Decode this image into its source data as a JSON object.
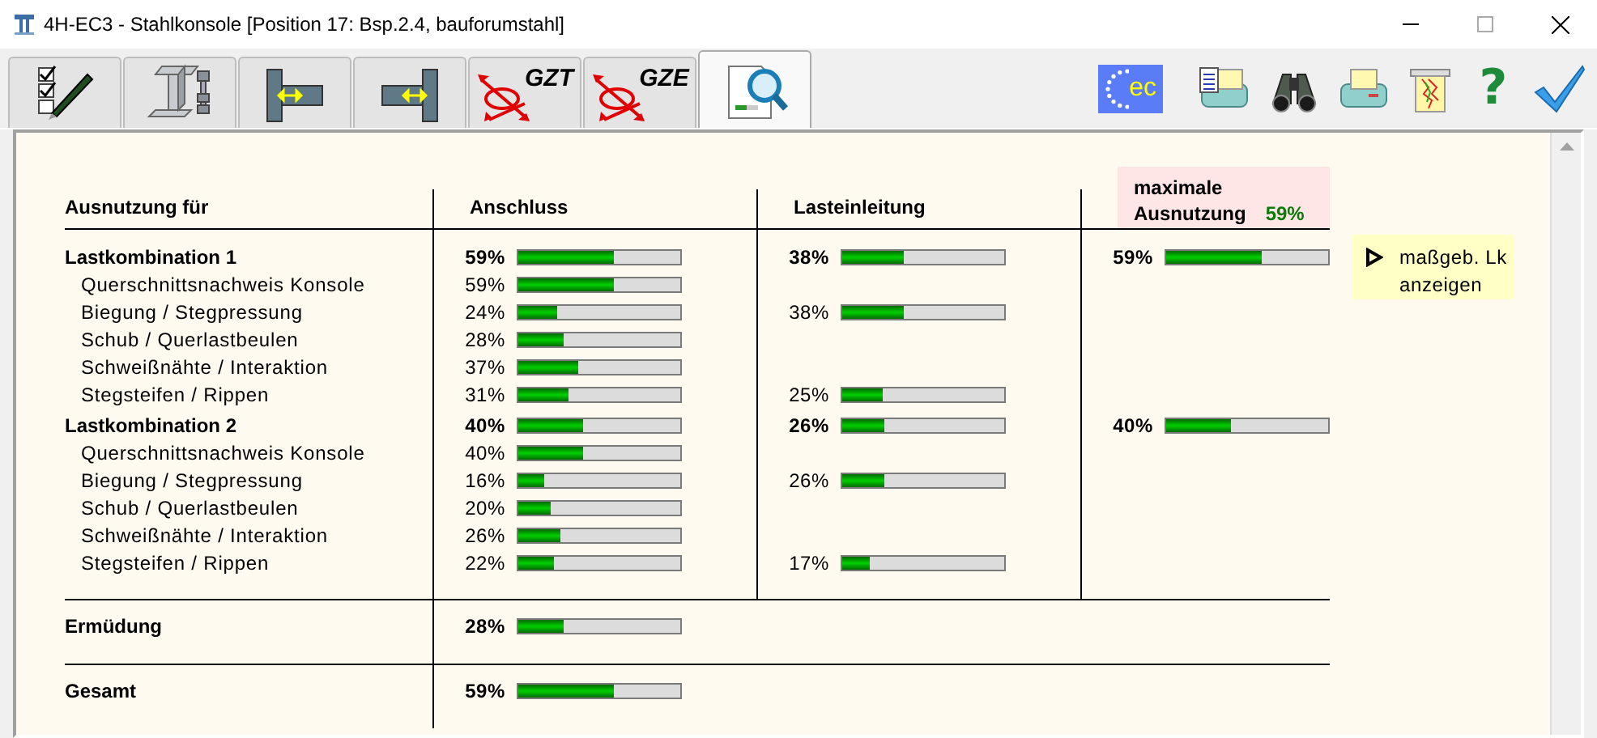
{
  "window": {
    "title": "4H-EC3 - Stahlkonsole [Position 17: Bsp.2.4, bauforumstahl]"
  },
  "tabs": [
    {
      "kind": "checklist",
      "selected": false
    },
    {
      "kind": "beam",
      "selected": false
    },
    {
      "kind": "connection-left",
      "selected": false
    },
    {
      "kind": "connection-right",
      "selected": false
    },
    {
      "kind": "loads",
      "label": "GZT",
      "selected": false
    },
    {
      "kind": "loads",
      "label": "GZE",
      "selected": false
    },
    {
      "kind": "results",
      "selected": true
    }
  ],
  "toolbar": [
    {
      "kind": "eurocode",
      "label": "ec"
    },
    {
      "kind": "print-list"
    },
    {
      "kind": "binoculars"
    },
    {
      "kind": "printer"
    },
    {
      "kind": "graph-sheet"
    },
    {
      "kind": "help",
      "label": "?"
    },
    {
      "kind": "confirm"
    }
  ],
  "table": {
    "columns": [
      "Ausnutzung für",
      "Anschluss",
      "Lasteinleitung"
    ],
    "maximum_header": {
      "line1": "maximale",
      "line2": "Ausnutzung",
      "value": "59%"
    },
    "sections": [
      {
        "rows": [
          {
            "kind": "group",
            "label": "Lastkombination 1",
            "anschluss": {
              "value": "59%",
              "level": 0.59
            },
            "lasteinleitung": {
              "value": "38%",
              "level": 0.38
            },
            "maximum": {
              "value": "59%",
              "level": 0.59
            }
          },
          {
            "kind": "item",
            "label": "Querschnittsnachweis Konsole",
            "anschluss": {
              "value": "59%",
              "level": 0.59
            }
          },
          {
            "kind": "item",
            "label": "Biegung / Stegpressung",
            "anschluss": {
              "value": "24%",
              "level": 0.24
            },
            "lasteinleitung": {
              "value": "38%",
              "level": 0.38
            }
          },
          {
            "kind": "item",
            "label": "Schub / Querlastbeulen",
            "anschluss": {
              "value": "28%",
              "level": 0.28
            }
          },
          {
            "kind": "item",
            "label": "Schweißnähte / Interaktion",
            "anschluss": {
              "value": "37%",
              "level": 0.37
            }
          },
          {
            "kind": "item",
            "label": "Stegsteifen / Rippen",
            "anschluss": {
              "value": "31%",
              "level": 0.31
            },
            "lasteinleitung": {
              "value": "25%",
              "level": 0.25
            }
          },
          {
            "kind": "group",
            "label": "Lastkombination 2",
            "anschluss": {
              "value": "40%",
              "level": 0.4
            },
            "lasteinleitung": {
              "value": "26%",
              "level": 0.26
            },
            "maximum": {
              "value": "40%",
              "level": 0.4
            }
          },
          {
            "kind": "item",
            "label": "Querschnittsnachweis Konsole",
            "anschluss": {
              "value": "40%",
              "level": 0.4
            }
          },
          {
            "kind": "item",
            "label": "Biegung / Stegpressung",
            "anschluss": {
              "value": "16%",
              "level": 0.16
            },
            "lasteinleitung": {
              "value": "26%",
              "level": 0.26
            }
          },
          {
            "kind": "item",
            "label": "Schub / Querlastbeulen",
            "anschluss": {
              "value": "20%",
              "level": 0.2
            }
          },
          {
            "kind": "item",
            "label": "Schweißnähte / Interaktion",
            "anschluss": {
              "value": "26%",
              "level": 0.26
            }
          },
          {
            "kind": "item",
            "label": "Stegsteifen / Rippen",
            "anschluss": {
              "value": "22%",
              "level": 0.22
            },
            "lasteinleitung": {
              "value": "17%",
              "level": 0.17
            }
          }
        ]
      },
      {
        "rows": [
          {
            "kind": "group",
            "label": "Ermüdung",
            "anschluss": {
              "value": "28%",
              "level": 0.28
            }
          }
        ]
      },
      {
        "rows": [
          {
            "kind": "group",
            "label": "Gesamt",
            "anschluss": {
              "value": "59%",
              "level": 0.59
            }
          }
        ]
      }
    ]
  },
  "button": {
    "label": "maßgeb. Lk anzeigen"
  }
}
